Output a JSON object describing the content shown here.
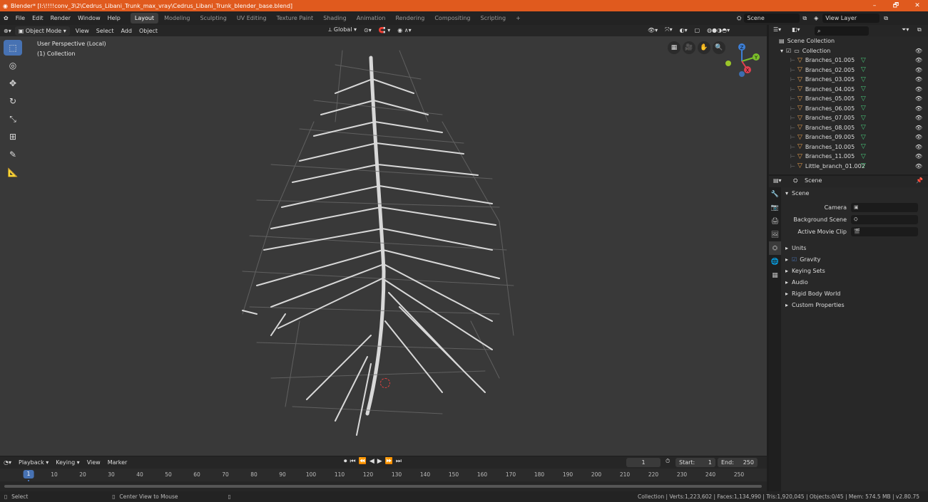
{
  "window": {
    "title": "Blender* [I:\\!!!!conv_3\\2\\Cedrus_Libani_Trunk_max_vray\\Cedrus_Libani_Trunk_blender_base.blend]",
    "minimize": "–",
    "maximize": "🗗",
    "close": "✕"
  },
  "menu": [
    "File",
    "Edit",
    "Render",
    "Window",
    "Help"
  ],
  "workspaces": [
    "Layout",
    "Modeling",
    "Sculpting",
    "UV Editing",
    "Texture Paint",
    "Shading",
    "Animation",
    "Rendering",
    "Compositing",
    "Scripting"
  ],
  "workspace_add": "+",
  "scene_selector": "Scene",
  "view_layer_selector": "View Layer",
  "viewport_header": {
    "mode": "Object Mode",
    "menus": [
      "View",
      "Select",
      "Add",
      "Object"
    ],
    "transform_orientation": "Global"
  },
  "viewport": {
    "perspective": "User Perspective (Local)",
    "collection": "(1) Collection",
    "gizmo_axes": {
      "x": "X",
      "y": "Y",
      "z": "Z"
    }
  },
  "outliner": {
    "search_placeholder": "",
    "scene_collection": "Scene Collection",
    "collection": "Collection",
    "items": [
      "Branches_01.005",
      "Branches_02.005",
      "Branches_03.005",
      "Branches_04.005",
      "Branches_05.005",
      "Branches_06.005",
      "Branches_07.005",
      "Branches_08.005",
      "Branches_09.005",
      "Branches_10.005",
      "Branches_11.005",
      "Little_branch_01.002"
    ]
  },
  "properties": {
    "context": "Scene",
    "panel": "Scene",
    "fields": [
      {
        "label": "Camera",
        "icon": "camera-icon"
      },
      {
        "label": "Background Scene",
        "icon": "scene-icon"
      },
      {
        "label": "Active Movie Clip",
        "icon": "clip-icon"
      }
    ],
    "subpanels": [
      "Units",
      "Gravity",
      "Keying Sets",
      "Audio",
      "Rigid Body World",
      "Custom Properties"
    ],
    "gravity_checked": true
  },
  "timeline": {
    "menus": [
      "Playback",
      "Keying",
      "View",
      "Marker"
    ],
    "current_frame": "1",
    "start_label": "Start:",
    "start": "1",
    "end_label": "End:",
    "end": "250",
    "ruler": [
      "1",
      "10",
      "20",
      "30",
      "40",
      "50",
      "60",
      "70",
      "80",
      "90",
      "100",
      "110",
      "120",
      "130",
      "140",
      "150",
      "160",
      "170",
      "180",
      "190",
      "200",
      "210",
      "220",
      "230",
      "240",
      "250"
    ]
  },
  "status": {
    "select": "Select",
    "center_view": "Center View to Mouse",
    "stats": "Collection | Verts:1,223,602 | Faces:1,134,990 | Tris:1,920,045 | Objects:0/45 | Mem: 574.5 MB | v2.80.75"
  },
  "colors": {
    "accent": "#4772b3",
    "title_bar": "#e05a1e",
    "object_orange": "#e39a4a",
    "mesh_green": "#49c77a"
  }
}
